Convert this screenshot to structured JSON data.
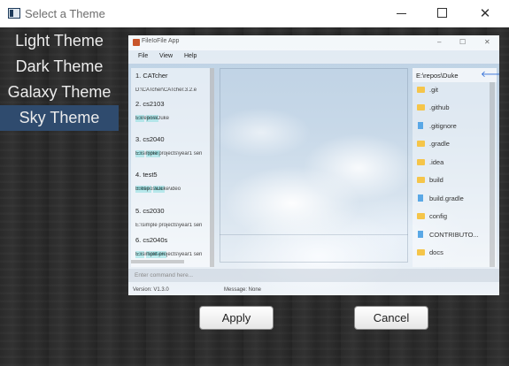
{
  "window": {
    "title": "Select a Theme",
    "minimize_icon": "minimize-icon",
    "maximize_icon": "maximize-icon",
    "close_glyph": "✕"
  },
  "themes": {
    "items": [
      {
        "label": "Light Theme"
      },
      {
        "label": "Dark Theme"
      },
      {
        "label": "Galaxy Theme"
      },
      {
        "label": "Sky Theme"
      }
    ],
    "selected": "Sky Theme"
  },
  "preview": {
    "app_title": "FileIoFile App",
    "window_controls": [
      "–",
      "☐",
      "✕"
    ],
    "menu": [
      "File",
      "View",
      "Help"
    ],
    "list": [
      {
        "title": "1.  CATcher",
        "tags": [],
        "path": "D:\\CATcher\\CATcher.3.2.e"
      },
      {
        "title": "2.  cs2103",
        "tags": [
          "cs",
          "core"
        ],
        "path": "E:\\repos\\Duke"
      },
      {
        "title": "3.  cs2040",
        "tags": [
          "cs",
          "good"
        ],
        "path": "E:\\simple projects\\year1 sen"
      },
      {
        "title": "4.  test5",
        "tags": [
          "folder",
          "test"
        ],
        "path": "E:\\repos\\Duke\\ideo"
      },
      {
        "title": "5.  cs2030",
        "tags": [],
        "path": "E:\\simple projects\\year1 sen"
      },
      {
        "title": "6.  cs2040s",
        "tags": [
          "cs",
          "lastSem"
        ],
        "path": "E:\\simple projects\\year1 sen"
      }
    ],
    "right_path": "E:\\repos\\Duke",
    "back_arrow": "🡐",
    "files": [
      {
        "name": ".git",
        "type": "folder"
      },
      {
        "name": ".github",
        "type": "folder"
      },
      {
        "name": ".gitignore",
        "type": "file"
      },
      {
        "name": ".gradle",
        "type": "folder"
      },
      {
        "name": ".idea",
        "type": "folder"
      },
      {
        "name": "build",
        "type": "folder"
      },
      {
        "name": "build.gradle",
        "type": "file"
      },
      {
        "name": "config",
        "type": "folder"
      },
      {
        "name": "CONTRIBUTO...",
        "type": "file"
      },
      {
        "name": "docs",
        "type": "folder"
      }
    ],
    "command_placeholder": "Enter command here...",
    "version": "Version: V1.3.0",
    "message": "Message:  None"
  },
  "buttons": {
    "apply": "Apply",
    "cancel": "Cancel"
  },
  "colors": {
    "selected_theme_bg": "#2f4b6e",
    "folder": "#f5c54a",
    "file": "#5aa8e6",
    "tag_text": "#1a7a7a"
  }
}
